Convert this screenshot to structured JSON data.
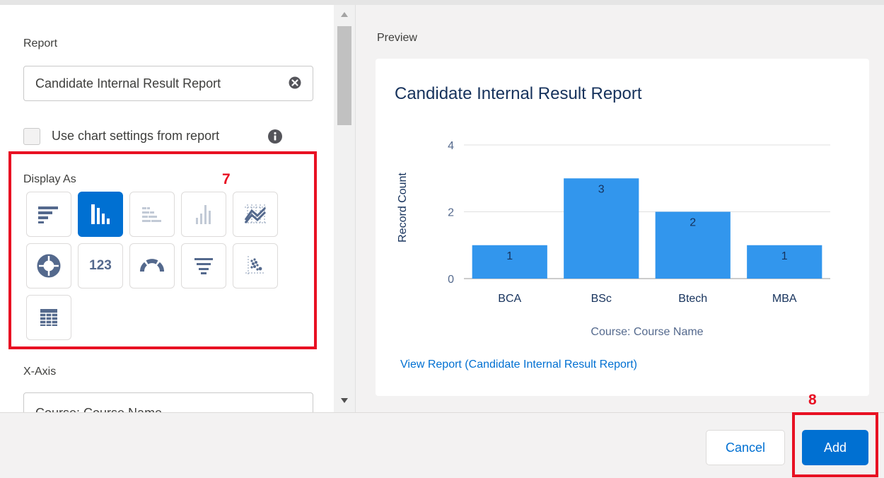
{
  "report": {
    "label": "Report",
    "value": "Candidate Internal Result Report"
  },
  "chart_settings": {
    "label": "Use chart settings from report",
    "checked": false
  },
  "display_as": {
    "label": "Display As",
    "options": [
      {
        "icon": "horizontal-bar-chart-icon",
        "selected": false
      },
      {
        "icon": "vertical-bar-chart-icon",
        "selected": true
      },
      {
        "icon": "stacked-horizontal-bar-icon",
        "disabled": true
      },
      {
        "icon": "stacked-vertical-bar-icon",
        "disabled": true
      },
      {
        "icon": "line-chart-icon",
        "selected": false
      },
      {
        "icon": "donut-chart-icon",
        "selected": false
      },
      {
        "icon": "metric-icon",
        "text": "123",
        "selected": false
      },
      {
        "icon": "gauge-icon",
        "selected": false
      },
      {
        "icon": "funnel-icon",
        "selected": false
      },
      {
        "icon": "scatter-chart-icon",
        "selected": false
      },
      {
        "icon": "lightning-table-icon",
        "selected": false
      }
    ]
  },
  "x_axis": {
    "label": "X-Axis",
    "value": "Course: Course Name"
  },
  "preview": {
    "label": "Preview",
    "view_report_link": "View Report (Candidate Internal Result Report)"
  },
  "chart_data": {
    "type": "bar",
    "title": "Candidate Internal Result Report",
    "categories": [
      "BCA",
      "BSc",
      "Btech",
      "MBA"
    ],
    "values": [
      1,
      3,
      2,
      1
    ],
    "xlabel": "Course: Course Name",
    "ylabel": "Record Count",
    "ylim": [
      0,
      4
    ],
    "yticks": [
      0,
      2,
      4
    ],
    "bar_color": "#3296ed",
    "grid": true,
    "data_labels": true
  },
  "footer": {
    "cancel_label": "Cancel",
    "add_label": "Add"
  },
  "annotations": {
    "display_as_step": "7",
    "add_step": "8",
    "color": "#e81123"
  }
}
